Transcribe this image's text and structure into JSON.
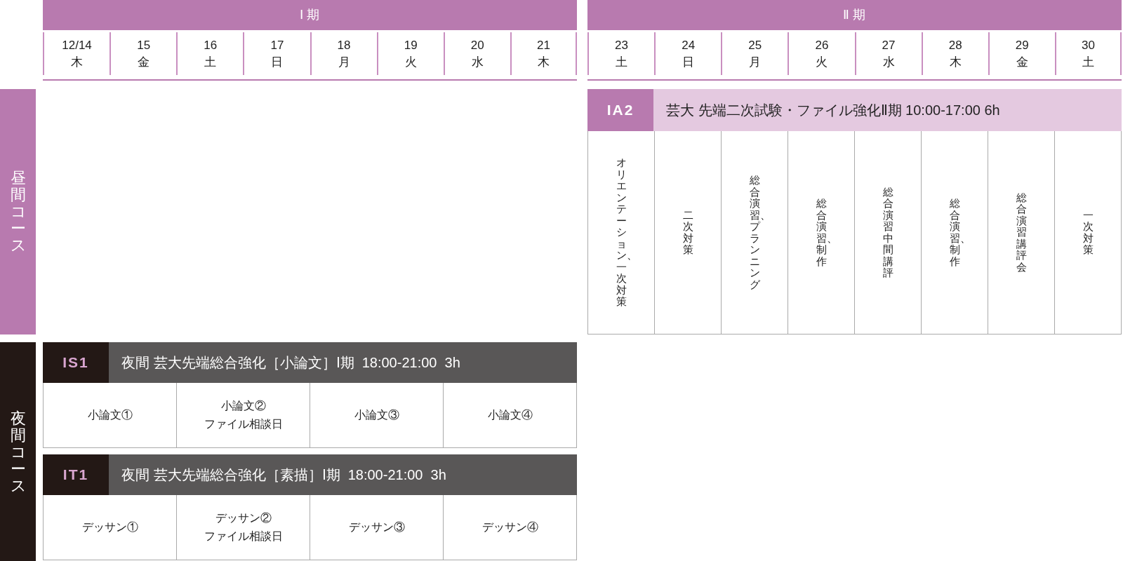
{
  "periods": [
    {
      "label": "Ⅰ 期",
      "days": [
        {
          "date": "12/14",
          "weekday": "木"
        },
        {
          "date": "15",
          "weekday": "金"
        },
        {
          "date": "16",
          "weekday": "土"
        },
        {
          "date": "17",
          "weekday": "日"
        },
        {
          "date": "18",
          "weekday": "月"
        },
        {
          "date": "19",
          "weekday": "火"
        },
        {
          "date": "20",
          "weekday": "水"
        },
        {
          "date": "21",
          "weekday": "木"
        }
      ]
    },
    {
      "label": "Ⅱ 期",
      "days": [
        {
          "date": "23",
          "weekday": "土"
        },
        {
          "date": "24",
          "weekday": "日"
        },
        {
          "date": "25",
          "weekday": "月"
        },
        {
          "date": "26",
          "weekday": "火"
        },
        {
          "date": "27",
          "weekday": "水"
        },
        {
          "date": "28",
          "weekday": "木"
        },
        {
          "date": "29",
          "weekday": "金"
        },
        {
          "date": "30",
          "weekday": "土"
        }
      ]
    }
  ],
  "sections": [
    {
      "label": "昼間コース",
      "kind": "day",
      "courses_period_2": [
        {
          "code": "IA2",
          "title": "芸大 先端二次試験・ファイル強化Ⅱ期 10:00-17:00 6h",
          "sessions": [
            "オリエンテーション、一次対策",
            "二次対策",
            "総合演習、プランニング",
            "総合演習、制作",
            "総合演習中間講評",
            "総合演習、制作",
            "総合演習講評会",
            "一次対策"
          ]
        }
      ]
    },
    {
      "label": "夜間コース",
      "kind": "night",
      "courses_period_1": [
        {
          "code": "IS1",
          "title": "夜間 芸大先端総合強化［小論文］Ⅰ期  18:00-21:00  3h",
          "sessions": [
            "小論文①",
            "小論文②\nファイル相談日",
            "小論文③",
            "小論文④"
          ]
        },
        {
          "code": "IT1",
          "title": "夜間 芸大先端総合強化［素描］Ⅰ期  18:00-21:00  3h",
          "sessions": [
            "デッサン①",
            "デッサン②\nファイル相談日",
            "デッサン③",
            "デッサン④"
          ]
        }
      ]
    }
  ]
}
